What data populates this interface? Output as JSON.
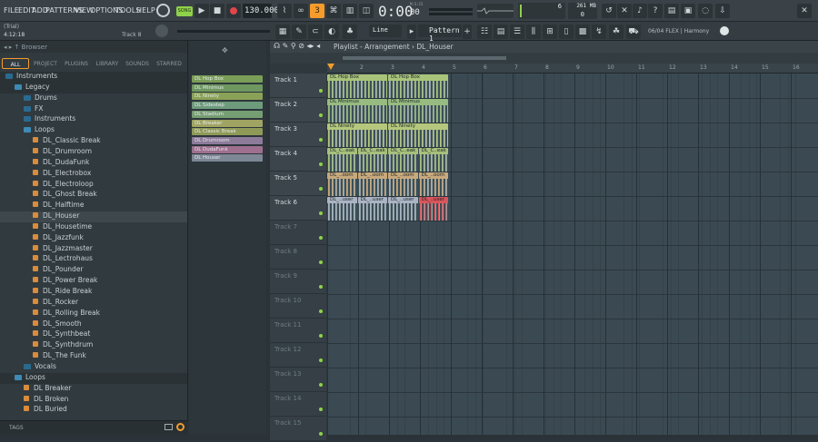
{
  "menu": [
    "FILE",
    "EDIT",
    "ADD",
    "PATTERNS",
    "VIEW",
    "OPTIONS",
    "TOOLS",
    "HELP"
  ],
  "transport": {
    "song_label": "SONG",
    "tempo": "130.000",
    "time_main": "0:00",
    "time_sub": "00",
    "time_unit": "M:S:CS",
    "cpu": "6",
    "ram": "261 MB",
    "ram_sub": "0",
    "snap": "Line",
    "pattern": "Pattern 1"
  },
  "hint": {
    "trial": "(Trial)",
    "position": "4:12:18",
    "track": "Track 8"
  },
  "info_panel": {
    "text": "06/04  FLEX | Harmony"
  },
  "browser": {
    "title": "Browser",
    "tabs": [
      "ALL",
      "PROJECT",
      "PLUGINS",
      "LIBRARY",
      "SOUNDS",
      "STARRED"
    ],
    "tree": [
      {
        "label": "Instruments",
        "type": "folder",
        "indent": 0,
        "open": false
      },
      {
        "label": "Legacy",
        "type": "folder",
        "indent": 1,
        "open": true
      },
      {
        "label": "Drums",
        "type": "folder",
        "indent": 2,
        "open": false
      },
      {
        "label": "FX",
        "type": "folder",
        "indent": 2,
        "open": false
      },
      {
        "label": "Instruments",
        "type": "folder",
        "indent": 2,
        "open": false
      },
      {
        "label": "Loops",
        "type": "folder",
        "indent": 2,
        "open": true
      },
      {
        "label": "DL_Classic Break",
        "type": "file",
        "indent": 3
      },
      {
        "label": "DL_Drumroom",
        "type": "file",
        "indent": 3
      },
      {
        "label": "DL_DudaFunk",
        "type": "file",
        "indent": 3
      },
      {
        "label": "DL_Electrobox",
        "type": "file",
        "indent": 3
      },
      {
        "label": "DL_Electroloop",
        "type": "file",
        "indent": 3
      },
      {
        "label": "DL_Ghost Break",
        "type": "file",
        "indent": 3
      },
      {
        "label": "DL_Halftime",
        "type": "file",
        "indent": 3
      },
      {
        "label": "DL_Houser",
        "type": "file",
        "indent": 3,
        "selected": true
      },
      {
        "label": "DL_Housetime",
        "type": "file",
        "indent": 3
      },
      {
        "label": "DL_Jazzfunk",
        "type": "file",
        "indent": 3
      },
      {
        "label": "DL_Jazzmaster",
        "type": "file",
        "indent": 3
      },
      {
        "label": "DL_Lectrohaus",
        "type": "file",
        "indent": 3
      },
      {
        "label": "DL_Pounder",
        "type": "file",
        "indent": 3
      },
      {
        "label": "DL_Power Break",
        "type": "file",
        "indent": 3
      },
      {
        "label": "DL_Ride Break",
        "type": "file",
        "indent": 3
      },
      {
        "label": "DL_Rocker",
        "type": "file",
        "indent": 3
      },
      {
        "label": "DL_Rolling Break",
        "type": "file",
        "indent": 3
      },
      {
        "label": "DL_Smooth",
        "type": "file",
        "indent": 3
      },
      {
        "label": "DL_Synthbeat",
        "type": "file",
        "indent": 3
      },
      {
        "label": "DL_Synthdrum",
        "type": "file",
        "indent": 3
      },
      {
        "label": "DL_The Funk",
        "type": "file",
        "indent": 3
      },
      {
        "label": "Vocals",
        "type": "folder",
        "indent": 2,
        "open": false
      },
      {
        "label": "Loops",
        "type": "folder",
        "indent": 1,
        "open": true
      },
      {
        "label": "DL Breaker",
        "type": "file",
        "indent": 2
      },
      {
        "label": "DL Broken",
        "type": "file",
        "indent": 2
      },
      {
        "label": "DL Buried",
        "type": "file",
        "indent": 2
      }
    ],
    "tags_label": "TAGS"
  },
  "rack": {
    "items": [
      {
        "label": "DL Hop Box",
        "color": "#7a9e57"
      },
      {
        "label": "DL Minimus",
        "color": "#6f9860"
      },
      {
        "label": "DL Ninety",
        "color": "#8aa257"
      },
      {
        "label": "DL Sidestep",
        "color": "#6f9b7d"
      },
      {
        "label": "DL Stadium",
        "color": "#769e73"
      },
      {
        "label": "DL Breaker",
        "color": "#a0a462"
      },
      {
        "label": "DL Classic Break",
        "color": "#8f9a57"
      },
      {
        "label": "DL Drumroom",
        "color": "#8d7b9a"
      },
      {
        "label": "DL DudaFunk",
        "color": "#9e6f8f"
      },
      {
        "label": "DL Houser",
        "color": "#7d8796"
      }
    ]
  },
  "playlist": {
    "title": "Playlist - Arrangement › DL_Houser",
    "ruler": [
      "2",
      "3",
      "4",
      "5",
      "6",
      "7",
      "8",
      "9",
      "10",
      "11",
      "12",
      "13",
      "14",
      "15",
      "16"
    ],
    "tracks": [
      "Track 1",
      "Track 2",
      "Track 3",
      "Track 4",
      "Track 5",
      "Track 6",
      "Track 7",
      "Track 8",
      "Track 9",
      "Track 10",
      "Track 11",
      "Track 12",
      "Track 13",
      "Track 14",
      "Track 15"
    ],
    "clips": [
      {
        "track": 0,
        "labels": [
          "DL Hop Box",
          "DL Hop Box"
        ],
        "color": "#a9c47a"
      },
      {
        "track": 1,
        "labels": [
          "DL Minimus",
          "DL Minimus"
        ],
        "color": "#97bb80"
      },
      {
        "track": 2,
        "labels": [
          "DL Ninety",
          "DL Ninety"
        ],
        "color": "#b4c77c"
      },
      {
        "track": 3,
        "labels": [
          "DL_C..eak",
          "DL_C..eak",
          "DL_C..eak",
          "DL_C..eak"
        ],
        "color": "#a7c07c"
      },
      {
        "track": 4,
        "labels": [
          "DL_..oom",
          "DL_..oom",
          "DL_..oom",
          "DL_..oom"
        ],
        "color": "#c7a97c"
      },
      {
        "track": 5,
        "labels": [
          "DL_..user",
          "DL_..user",
          "DL_..user",
          "DL_..user"
        ],
        "color": "#aab4c4",
        "last_color": "#d9565c"
      }
    ]
  },
  "colors": {
    "accent": "#f59c2b",
    "song": "#8fd24a",
    "led": "#8fd24a"
  }
}
